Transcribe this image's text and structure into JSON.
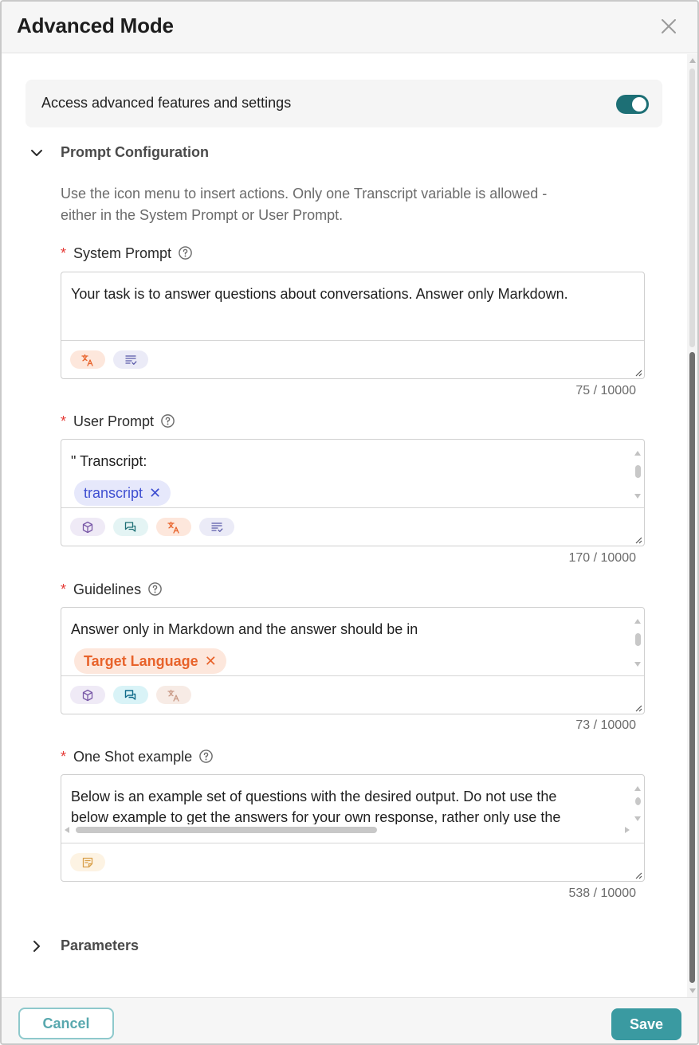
{
  "dialog": {
    "title": "Advanced Mode",
    "close_icon": "close-icon"
  },
  "toggle_card": {
    "label": "Access advanced features and settings",
    "enabled": true,
    "toggle_color": "#1d6f75"
  },
  "prompt_config": {
    "title": "Prompt Configuration",
    "expanded": true,
    "helper_line1": "Use the icon menu to insert actions. Only one Transcript variable is allowed -",
    "helper_line2": "either in the System Prompt or User Prompt."
  },
  "fields": [
    {
      "label": "System Prompt",
      "required": "*",
      "text": "Your task is to answer questions about conversations. Answer only Markdown.",
      "counter": "75 / 10000",
      "tools": [
        "translate-icon",
        "list-check-icon"
      ]
    },
    {
      "label": "User Prompt",
      "required": "*",
      "text": "\" Transcript:",
      "chip": "transcript",
      "counter": "170 / 10000",
      "tools": [
        "cube-icon",
        "chat-icon",
        "translate-icon",
        "list-check-icon"
      ]
    },
    {
      "label": "Guidelines",
      "required": "*",
      "text": "Answer only in Markdown and the answer should be in",
      "chip": "Target Language",
      "counter": "73 / 10000",
      "tools": [
        "cube-icon",
        "chat-icon",
        "translate-icon"
      ]
    },
    {
      "label": "One Shot example",
      "required": "*",
      "text_line1": "Below is an example set of questions with the desired output. Do not use the",
      "text_line2": "below example to get the answers for your own response, rather only use the",
      "counter": "538 / 10000",
      "tools": [
        "note-icon"
      ]
    }
  ],
  "parameters": {
    "title": "Parameters",
    "expanded": false
  },
  "footer": {
    "cancel_label": "Cancel",
    "save_label": "Save"
  },
  "colors": {
    "accent": "#3a9aa1",
    "required_star": "#e53935",
    "transcript_chip": "#3f4fd1",
    "target_language_chip": "#e8632b"
  }
}
